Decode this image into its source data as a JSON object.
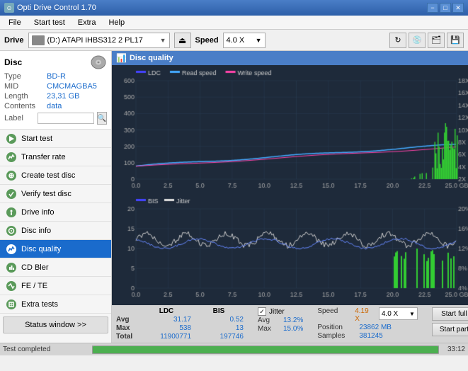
{
  "titlebar": {
    "title": "Opti Drive Control 1.70",
    "minimize": "−",
    "maximize": "□",
    "close": "✕"
  },
  "menubar": {
    "items": [
      "File",
      "Start test",
      "Extra",
      "Help"
    ]
  },
  "drivebar": {
    "drive_label": "Drive",
    "drive_value": "(D:) ATAPI iHBS312  2 PL17",
    "speed_label": "Speed",
    "speed_value": "4.0 X"
  },
  "disc": {
    "header": "Disc",
    "type_label": "Type",
    "type_value": "BD-R",
    "mid_label": "MID",
    "mid_value": "CMCMAGBA5",
    "length_label": "Length",
    "length_value": "23,31 GB",
    "contents_label": "Contents",
    "contents_value": "data",
    "label_label": "Label",
    "label_placeholder": ""
  },
  "nav": {
    "items": [
      {
        "id": "start-test",
        "label": "Start test",
        "active": false
      },
      {
        "id": "transfer-rate",
        "label": "Transfer rate",
        "active": false
      },
      {
        "id": "create-test-disc",
        "label": "Create test disc",
        "active": false
      },
      {
        "id": "verify-test-disc",
        "label": "Verify test disc",
        "active": false
      },
      {
        "id": "drive-info",
        "label": "Drive info",
        "active": false
      },
      {
        "id": "disc-info",
        "label": "Disc info",
        "active": false
      },
      {
        "id": "disc-quality",
        "label": "Disc quality",
        "active": true
      },
      {
        "id": "cd-bler",
        "label": "CD Bler",
        "active": false
      },
      {
        "id": "fe-te",
        "label": "FE / TE",
        "active": false
      },
      {
        "id": "extra-tests",
        "label": "Extra tests",
        "active": false
      }
    ],
    "status_window": "Status window >>"
  },
  "chart": {
    "title": "Disc quality",
    "legend_upper": [
      {
        "label": "LDC",
        "color": "#4444ff"
      },
      {
        "label": "Read speed",
        "color": "#44aaff"
      },
      {
        "label": "Write speed",
        "color": "#ff44aa"
      }
    ],
    "legend_lower": [
      {
        "label": "BIS",
        "color": "#4444ff"
      },
      {
        "label": "Jitter",
        "color": "#dddddd"
      }
    ],
    "x_labels": [
      "0.0",
      "2.5",
      "5.0",
      "7.5",
      "10.0",
      "12.5",
      "15.0",
      "17.5",
      "20.0",
      "22.5",
      "25.0 GB"
    ],
    "y_left_upper": [
      "600",
      "500",
      "400",
      "300",
      "200",
      "100",
      "0"
    ],
    "y_right_upper": [
      "18X",
      "16X",
      "14X",
      "12X",
      "10X",
      "8X",
      "6X",
      "4X",
      "2X"
    ],
    "y_left_lower": [
      "20",
      "15",
      "10",
      "5",
      "0"
    ],
    "y_right_lower": [
      "20%",
      "16%",
      "12%",
      "8%",
      "4%"
    ]
  },
  "stats": {
    "col_headers": [
      "",
      "LDC",
      "BIS"
    ],
    "avg_label": "Avg",
    "avg_ldc": "31.17",
    "avg_bis": "0.52",
    "max_label": "Max",
    "max_ldc": "538",
    "max_bis": "13",
    "total_label": "Total",
    "total_ldc": "11900771",
    "total_bis": "197746",
    "jitter_label": "Jitter",
    "jitter_checked": true,
    "jitter_avg": "13.2%",
    "jitter_max": "15.0%",
    "speed_label": "Speed",
    "speed_value": "4.19 X",
    "speed_setting": "4.0 X",
    "position_label": "Position",
    "position_value": "23862 MB",
    "samples_label": "Samples",
    "samples_value": "381245",
    "btn_start_full": "Start full",
    "btn_start_part": "Start part"
  },
  "statusbar": {
    "text": "Test completed",
    "progress": 100,
    "time": "33:12"
  }
}
